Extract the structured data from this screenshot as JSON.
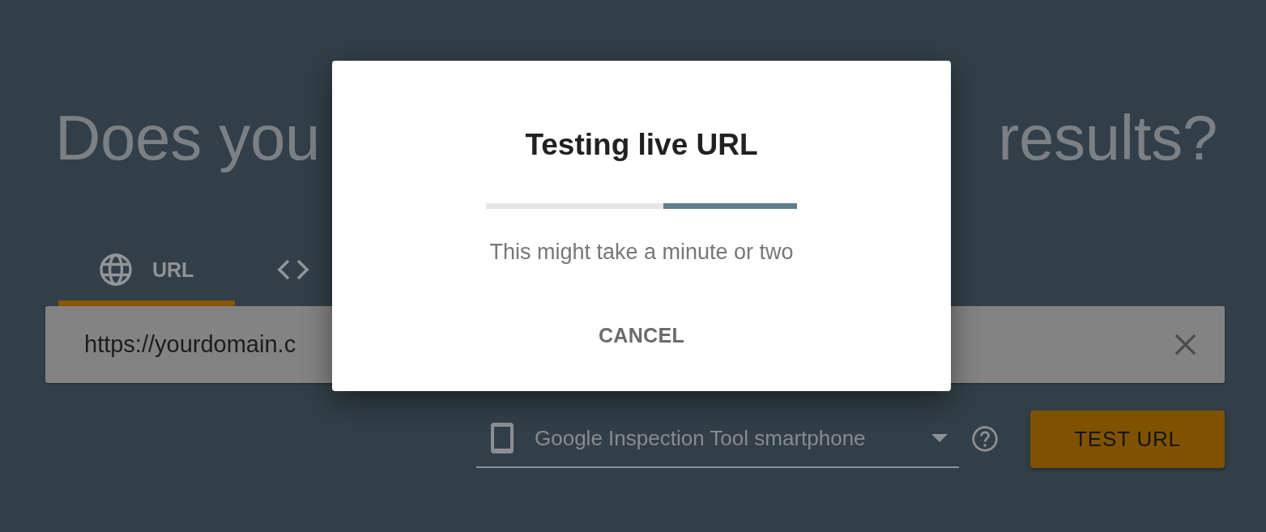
{
  "heading": {
    "start": "Does you",
    "end": "results?"
  },
  "tabs": [
    {
      "label": "URL",
      "selected": true
    },
    {
      "selected": false
    }
  ],
  "url_field": {
    "value": "https://yourdomain.c"
  },
  "device_select": {
    "value": "Google Inspection Tool smartphone"
  },
  "test_button": {
    "label": "TEST URL"
  },
  "dialog": {
    "title": "Testing live URL",
    "progress": {
      "level": 0.43
    },
    "message": "This might take a minute or two",
    "cancel_button": {
      "label": "CANCEL"
    }
  }
}
